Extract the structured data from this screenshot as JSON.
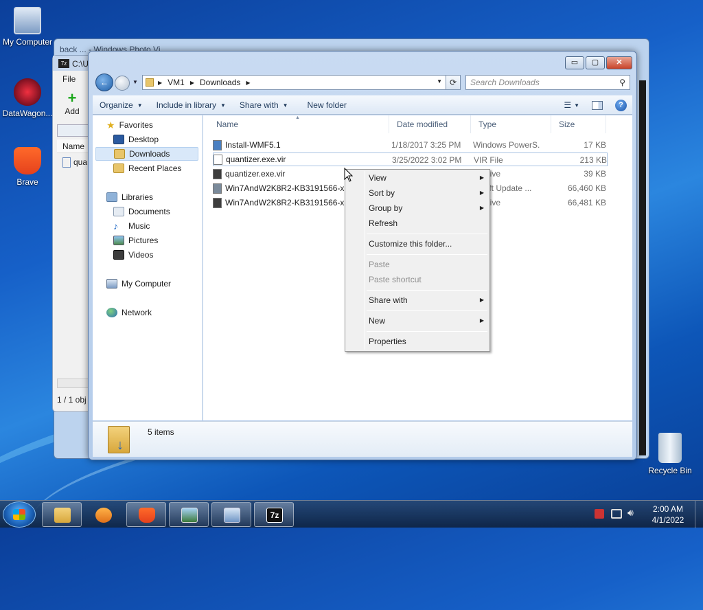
{
  "desktop": {
    "icons": [
      {
        "label": "My Computer"
      },
      {
        "label": "DataWagon..."
      },
      {
        "label": "Brave"
      },
      {
        "label": "Recycle Bin"
      }
    ]
  },
  "bg_windows": {
    "photo_viewer_title_fragment": "back ... - Windows Photo Vi...",
    "sevenzip": {
      "path_fragment": "C:\\U",
      "menu_file": "File",
      "add_label": "Add",
      "column_name": "Name",
      "row_fragment": "qua",
      "status_fragment": "1 / 1 obj"
    }
  },
  "explorer": {
    "caption_buttons": {
      "minimize": "▭",
      "maximize": "▢",
      "close": "✕"
    },
    "address": {
      "segments": [
        "VM1",
        "Downloads"
      ]
    },
    "search": {
      "placeholder": "Search Downloads"
    },
    "toolbar": {
      "organize": "Organize",
      "include_in_library": "Include in library",
      "share_with": "Share with",
      "new_folder": "New folder"
    },
    "nav": {
      "favorites": "Favorites",
      "desktop": "Desktop",
      "downloads": "Downloads",
      "recent_places": "Recent Places",
      "libraries": "Libraries",
      "documents": "Documents",
      "music": "Music",
      "pictures": "Pictures",
      "videos": "Videos",
      "my_computer": "My Computer",
      "network": "Network"
    },
    "columns": {
      "name": "Name",
      "date_modified": "Date modified",
      "type": "Type",
      "size": "Size"
    },
    "files": [
      {
        "name": "Install-WMF5.1",
        "date": "1/18/2017 3:25 PM",
        "type": "Windows PowerS...",
        "size": "17 KB",
        "icon_color": "#4a7fc1"
      },
      {
        "name": "quantizer.exe.vir",
        "date": "3/25/2022 3:02 PM",
        "type": "VIR File",
        "size": "213 KB",
        "icon_color": "#ffffff"
      },
      {
        "name": "quantizer.exe.vir",
        "date": "",
        "type": "Archive",
        "size": "39 KB",
        "icon_color": "#3d3d3d"
      },
      {
        "name": "Win7AndW2K8R2-KB3191566-x6",
        "date": "",
        "type": "rosoft Update ...",
        "size": "66,460 KB",
        "icon_color": "#7a8a9a"
      },
      {
        "name": "Win7AndW2K8R2-KB3191566-x6",
        "date": "",
        "type": "Archive",
        "size": "66,481 KB",
        "icon_color": "#3d3d3d"
      }
    ],
    "details": {
      "item_count": "5 items"
    }
  },
  "context_menu": {
    "items": [
      {
        "label": "View",
        "submenu": true,
        "disabled": false
      },
      {
        "label": "Sort by",
        "submenu": true,
        "disabled": false
      },
      {
        "label": "Group by",
        "submenu": true,
        "disabled": false
      },
      {
        "label": "Refresh",
        "submenu": false,
        "disabled": false
      },
      {
        "label": "Customize this folder...",
        "submenu": false,
        "disabled": false
      },
      {
        "label": "Paste",
        "submenu": false,
        "disabled": true
      },
      {
        "label": "Paste shortcut",
        "submenu": false,
        "disabled": true
      },
      {
        "label": "Share with",
        "submenu": true,
        "disabled": false
      },
      {
        "label": "New",
        "submenu": true,
        "disabled": false
      },
      {
        "label": "Properties",
        "submenu": false,
        "disabled": false
      }
    ]
  },
  "taskbar": {
    "clock_time": "2:00 AM",
    "clock_date": "4/1/2022",
    "sevenzip_label": "7z"
  }
}
